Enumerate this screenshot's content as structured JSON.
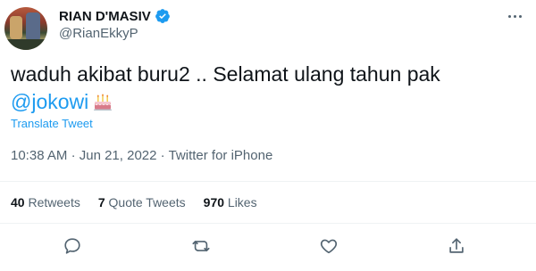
{
  "author": {
    "display_name": "RIAN D'MASIV",
    "handle": "@RianEkkyP",
    "verified": true
  },
  "icons": {
    "verified": "verified-badge-icon",
    "more": "more-options-icon",
    "cake": "birthday-cake-emoji",
    "reply": "reply-icon",
    "retweet": "retweet-icon",
    "like": "like-icon",
    "share": "share-icon"
  },
  "tweet": {
    "text_line1": "waduh akibat buru2 .. Selamat ulang tahun pak",
    "mention": "@jokowi",
    "translate_label": "Translate Tweet",
    "time": "10:38 AM",
    "date": "Jun 21, 2022",
    "source": "Twitter for iPhone"
  },
  "stats": {
    "retweets_count": "40",
    "retweets_label": "Retweets",
    "quotes_count": "7",
    "quotes_label": "Quote Tweets",
    "likes_count": "970",
    "likes_label": "Likes"
  },
  "colors": {
    "accent": "#1d9bf0",
    "text": "#0f1419",
    "secondary": "#536471",
    "divider": "#eff3f4"
  }
}
